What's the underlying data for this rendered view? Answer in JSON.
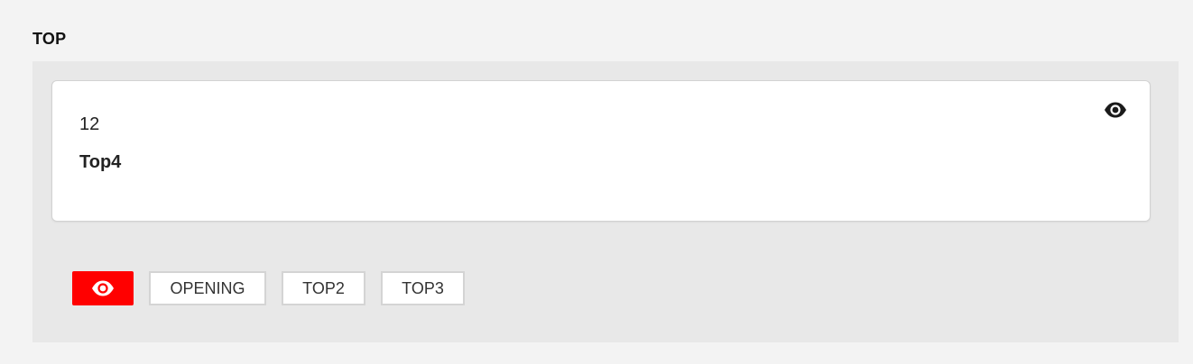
{
  "section": {
    "title": "TOP"
  },
  "card": {
    "number": "12",
    "title": "Top4",
    "visibility_icon": "eye-icon"
  },
  "tabs": [
    {
      "label": "",
      "icon": "eye-icon",
      "active": true
    },
    {
      "label": "OPENING",
      "active": false
    },
    {
      "label": "TOP2",
      "active": false
    },
    {
      "label": "TOP3",
      "active": false
    }
  ],
  "colors": {
    "accent": "#ff0000",
    "page_background": "#f3f3f3",
    "panel_background": "#e8e8e8",
    "card_background": "#ffffff"
  }
}
